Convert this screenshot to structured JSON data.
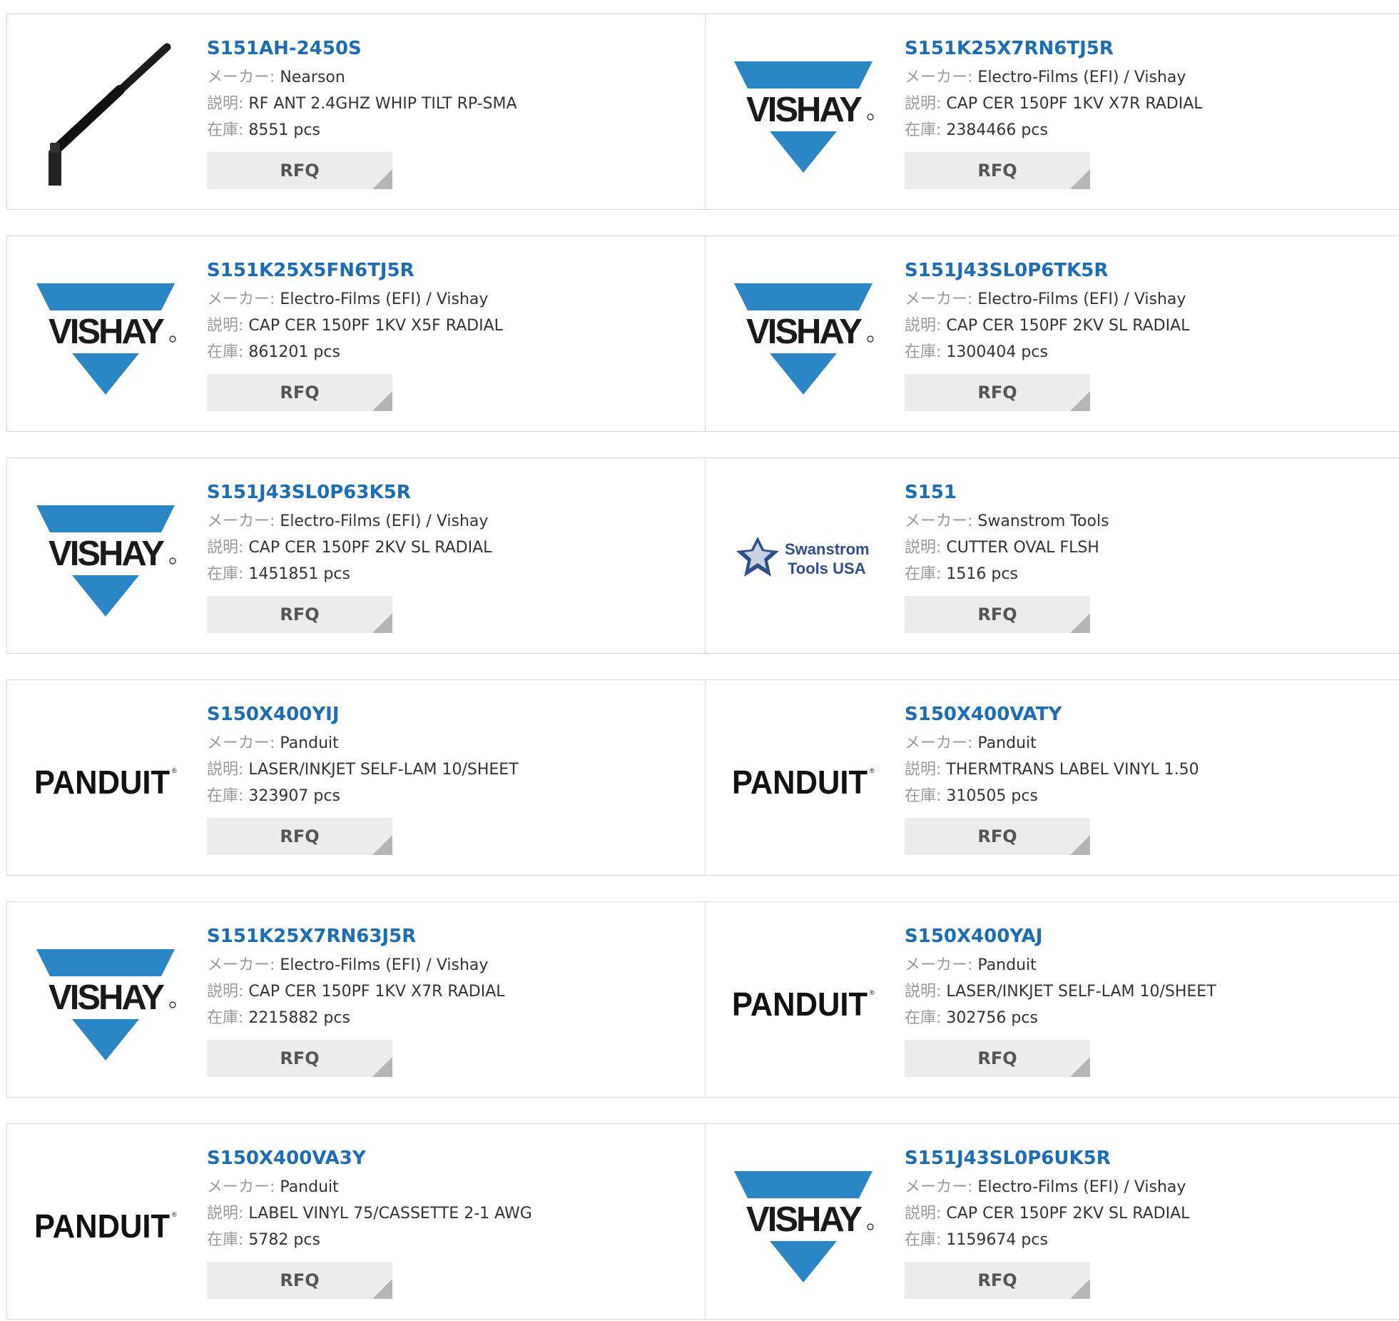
{
  "labels": {
    "maker": "メーカー:",
    "desc": "説明:",
    "stock": "在庫:"
  },
  "colors": {
    "link": "#1d6db5",
    "vishay_blue": "#2b86c6"
  },
  "rows": [
    {
      "items": [
        {
          "part": "S151AH-2450S",
          "maker": "Nearson",
          "desc": "RF ANT 2.4GHZ WHIP TILT RP-SMA",
          "stock": "8551 pcs",
          "logo": "antenna",
          "rfq": "RFQ"
        },
        {
          "part": "S151K25X7RN6TJ5R",
          "maker": "Electro-Films (EFI) / Vishay",
          "desc": "CAP CER 150PF 1KV X7R RADIAL",
          "stock": "2384466 pcs",
          "logo": "vishay",
          "rfq": "RFQ"
        }
      ]
    },
    {
      "items": [
        {
          "part": "S151K25X5FN6TJ5R",
          "maker": "Electro-Films (EFI) / Vishay",
          "desc": "CAP CER 150PF 1KV X5F RADIAL",
          "stock": "861201 pcs",
          "logo": "vishay",
          "rfq": "RFQ"
        },
        {
          "part": "S151J43SL0P6TK5R",
          "maker": "Electro-Films (EFI) / Vishay",
          "desc": "CAP CER 150PF 2KV SL RADIAL",
          "stock": "1300404 pcs",
          "logo": "vishay",
          "rfq": "RFQ"
        }
      ]
    },
    {
      "items": [
        {
          "part": "S151J43SL0P63K5R",
          "maker": "Electro-Films (EFI) / Vishay",
          "desc": "CAP CER 150PF 2KV SL RADIAL",
          "stock": "1451851 pcs",
          "logo": "vishay",
          "rfq": "RFQ"
        },
        {
          "part": "S151",
          "maker": "Swanstrom Tools",
          "desc": "CUTTER OVAL FLSH",
          "stock": "1516 pcs",
          "logo": "swanstrom",
          "logo_text": [
            "Swanstrom",
            "Tools USA"
          ],
          "rfq": "RFQ"
        }
      ]
    },
    {
      "items": [
        {
          "part": "S150X400YIJ",
          "maker": "Panduit",
          "desc": "LASER/INKJET SELF-LAM 10/SHEET",
          "stock": "323907 pcs",
          "logo": "panduit",
          "rfq": "RFQ"
        },
        {
          "part": "S150X400VATY",
          "maker": "Panduit",
          "desc": "THERMTRANS LABEL VINYL 1.50",
          "stock": "310505 pcs",
          "logo": "panduit",
          "rfq": "RFQ"
        }
      ]
    },
    {
      "items": [
        {
          "part": "S151K25X7RN63J5R",
          "maker": "Electro-Films (EFI) / Vishay",
          "desc": "CAP CER 150PF 1KV X7R RADIAL",
          "stock": "2215882 pcs",
          "logo": "vishay",
          "rfq": "RFQ"
        },
        {
          "part": "S150X400YAJ",
          "maker": "Panduit",
          "desc": "LASER/INKJET SELF-LAM 10/SHEET",
          "stock": "302756 pcs",
          "logo": "panduit",
          "rfq": "RFQ"
        }
      ]
    },
    {
      "items": [
        {
          "part": "S150X400VA3Y",
          "maker": "Panduit",
          "desc": "LABEL VINYL 75/CASSETTE 2-1 AWG",
          "stock": "5782 pcs",
          "logo": "panduit",
          "rfq": "RFQ"
        },
        {
          "part": "S151J43SL0P6UK5R",
          "maker": "Electro-Films (EFI) / Vishay",
          "desc": "CAP CER 150PF 2KV SL RADIAL",
          "stock": "1159674 pcs",
          "logo": "vishay",
          "rfq": "RFQ"
        }
      ]
    }
  ]
}
